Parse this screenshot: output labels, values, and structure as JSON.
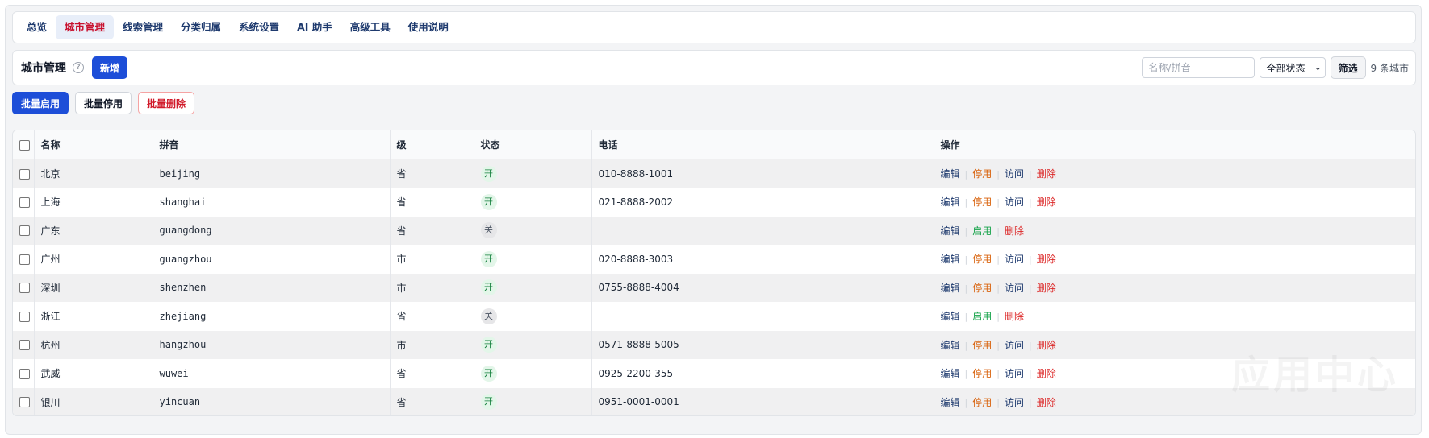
{
  "nav": {
    "items": [
      {
        "label": "总览",
        "active": false
      },
      {
        "label": "城市管理",
        "active": true
      },
      {
        "label": "线索管理",
        "active": false
      },
      {
        "label": "分类归属",
        "active": false
      },
      {
        "label": "系统设置",
        "active": false
      },
      {
        "label": "AI 助手",
        "active": false
      },
      {
        "label": "高级工具",
        "active": false
      },
      {
        "label": "使用说明",
        "active": false
      }
    ]
  },
  "toolbar": {
    "title": "城市管理",
    "help_symbol": "?",
    "add_label": "新增",
    "search_placeholder": "名称/拼音",
    "status_selected": "全部状态",
    "filter_label": "筛选",
    "count_text": "9 条城市"
  },
  "bulk": {
    "enable_label": "批量启用",
    "disable_label": "批量停用",
    "delete_label": "批量删除"
  },
  "table": {
    "headers": {
      "name": "名称",
      "pinyin": "拼音",
      "level": "级",
      "status": "状态",
      "phone": "电话",
      "actions": "操作"
    },
    "action_labels": {
      "edit": "编辑",
      "disable": "停用",
      "enable": "启用",
      "visit": "访问",
      "delete": "删除"
    },
    "rows": [
      {
        "name": "北京",
        "pinyin": "beijing",
        "level": "省",
        "status": "开",
        "on": true,
        "phone": "010-8888-1001"
      },
      {
        "name": "上海",
        "pinyin": "shanghai",
        "level": "省",
        "status": "开",
        "on": true,
        "phone": "021-8888-2002"
      },
      {
        "name": "广东",
        "pinyin": "guangdong",
        "level": "省",
        "status": "关",
        "on": false,
        "phone": ""
      },
      {
        "name": "广州",
        "pinyin": "guangzhou",
        "level": "市",
        "status": "开",
        "on": true,
        "phone": "020-8888-3003"
      },
      {
        "name": "深圳",
        "pinyin": "shenzhen",
        "level": "市",
        "status": "开",
        "on": true,
        "phone": "0755-8888-4004"
      },
      {
        "name": "浙江",
        "pinyin": "zhejiang",
        "level": "省",
        "status": "关",
        "on": false,
        "phone": ""
      },
      {
        "name": "杭州",
        "pinyin": "hangzhou",
        "level": "市",
        "status": "开",
        "on": true,
        "phone": "0571-8888-5005"
      },
      {
        "name": "武威",
        "pinyin": "wuwei",
        "level": "省",
        "status": "开",
        "on": true,
        "phone": "0925-2200-355"
      },
      {
        "name": "银川",
        "pinyin": "yincuan",
        "level": "省",
        "status": "开",
        "on": true,
        "phone": "0951-0001-0001"
      }
    ]
  },
  "watermark": "应用中心",
  "colors": {
    "primary": "#1d4ed8",
    "active_nav_text": "#c8102e",
    "disable_action": "#d9620c",
    "enable_action": "#16a34a",
    "delete_action": "#dc2626",
    "status_on_bg": "#e3f6e9"
  }
}
